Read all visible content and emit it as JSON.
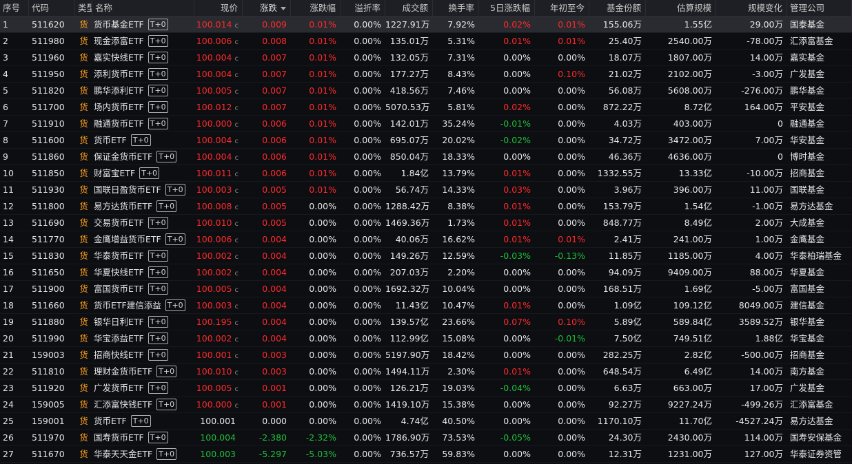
{
  "headers": [
    "序号",
    "代码",
    "类型",
    "名称",
    "现价",
    "涨跌",
    "涨跌幅",
    "溢折率",
    "成交额",
    "换手率",
    "5日涨跌幅",
    "年初至今",
    "基金份额",
    "估算规模",
    "规模变化",
    "管理公司"
  ],
  "rows": [
    {
      "no": "1",
      "code": "511620",
      "type": "货",
      "name": "货币基金ETF",
      "tag": "T+0",
      "price": "100.014",
      "chg": "0.009",
      "pct": "0.01%",
      "prem": "0.00%",
      "amount": "1227.91万",
      "turnover": "7.92%",
      "d5": "0.02%",
      "ytd": "0.01%",
      "shares": "155.06万",
      "scale": "1.55亿",
      "delta": "29.00万",
      "mgr": "国泰基金",
      "c": "red",
      "d5c": "red",
      "ytdc": "red",
      "sel": true
    },
    {
      "no": "2",
      "code": "511980",
      "type": "货",
      "name": "现金添富ETF",
      "tag": "T+0",
      "price": "100.006",
      "chg": "0.008",
      "pct": "0.01%",
      "prem": "0.00%",
      "amount": "135.01万",
      "turnover": "5.31%",
      "d5": "0.01%",
      "ytd": "0.01%",
      "shares": "25.40万",
      "scale": "2540.00万",
      "delta": "-78.00万",
      "mgr": "汇添富基金",
      "c": "red",
      "d5c": "red",
      "ytdc": "red"
    },
    {
      "no": "3",
      "code": "511960",
      "type": "货",
      "name": "嘉实快线ETF",
      "tag": "T+0",
      "price": "100.004",
      "chg": "0.007",
      "pct": "0.01%",
      "prem": "0.00%",
      "amount": "132.05万",
      "turnover": "7.31%",
      "d5": "0.00%",
      "ytd": "0.00%",
      "shares": "18.07万",
      "scale": "1807.00万",
      "delta": "14.00万",
      "mgr": "嘉实基金",
      "c": "red",
      "d5c": "white",
      "ytdc": "white"
    },
    {
      "no": "4",
      "code": "511950",
      "type": "货",
      "name": "添利货币ETF",
      "tag": "T+0",
      "price": "100.004",
      "chg": "0.007",
      "pct": "0.01%",
      "prem": "0.00%",
      "amount": "177.27万",
      "turnover": "8.43%",
      "d5": "0.00%",
      "ytd": "0.10%",
      "shares": "21.02万",
      "scale": "2102.00万",
      "delta": "-3.00万",
      "mgr": "广发基金",
      "c": "red",
      "d5c": "white",
      "ytdc": "red"
    },
    {
      "no": "5",
      "code": "511820",
      "type": "货",
      "name": "鹏华添利ETF",
      "tag": "T+0",
      "price": "100.005",
      "chg": "0.007",
      "pct": "0.01%",
      "prem": "0.00%",
      "amount": "418.56万",
      "turnover": "7.46%",
      "d5": "0.00%",
      "ytd": "0.00%",
      "shares": "56.08万",
      "scale": "5608.00万",
      "delta": "-276.00万",
      "mgr": "鹏华基金",
      "c": "red",
      "d5c": "white",
      "ytdc": "white"
    },
    {
      "no": "6",
      "code": "511700",
      "type": "货",
      "name": "场内货币ETF",
      "tag": "T+0",
      "price": "100.012",
      "chg": "0.007",
      "pct": "0.01%",
      "prem": "0.00%",
      "amount": "5070.53万",
      "turnover": "5.81%",
      "d5": "0.02%",
      "ytd": "0.00%",
      "shares": "872.22万",
      "scale": "8.72亿",
      "delta": "164.00万",
      "mgr": "平安基金",
      "c": "red",
      "d5c": "red",
      "ytdc": "white"
    },
    {
      "no": "7",
      "code": "511910",
      "type": "货",
      "name": "融通货币ETF",
      "tag": "T+0",
      "price": "100.000",
      "chg": "0.006",
      "pct": "0.01%",
      "prem": "0.00%",
      "amount": "142.01万",
      "turnover": "35.24%",
      "d5": "-0.01%",
      "ytd": "0.00%",
      "shares": "4.03万",
      "scale": "403.00万",
      "delta": "0",
      "mgr": "融通基金",
      "c": "red",
      "d5c": "green",
      "ytdc": "white"
    },
    {
      "no": "8",
      "code": "511600",
      "type": "货",
      "name": "货币ETF",
      "tag": "T+0",
      "price": "100.004",
      "chg": "0.006",
      "pct": "0.01%",
      "prem": "0.00%",
      "amount": "695.07万",
      "turnover": "20.02%",
      "d5": "-0.02%",
      "ytd": "0.00%",
      "shares": "34.72万",
      "scale": "3472.00万",
      "delta": "7.00万",
      "mgr": "华安基金",
      "c": "red",
      "d5c": "green",
      "ytdc": "white"
    },
    {
      "no": "9",
      "code": "511860",
      "type": "货",
      "name": "保证金货币ETF",
      "tag": "T+0",
      "price": "100.004",
      "chg": "0.006",
      "pct": "0.01%",
      "prem": "0.00%",
      "amount": "850.04万",
      "turnover": "18.33%",
      "d5": "0.00%",
      "ytd": "0.00%",
      "shares": "46.36万",
      "scale": "4636.00万",
      "delta": "0",
      "mgr": "博时基金",
      "c": "red",
      "d5c": "white",
      "ytdc": "white"
    },
    {
      "no": "10",
      "code": "511850",
      "type": "货",
      "name": "财富宝ETF",
      "tag": "T+0",
      "price": "100.011",
      "chg": "0.006",
      "pct": "0.01%",
      "prem": "0.00%",
      "amount": "1.84亿",
      "turnover": "13.79%",
      "d5": "0.01%",
      "ytd": "0.00%",
      "shares": "1332.55万",
      "scale": "13.33亿",
      "delta": "-10.00万",
      "mgr": "招商基金",
      "c": "red",
      "d5c": "red",
      "ytdc": "white"
    },
    {
      "no": "11",
      "code": "511930",
      "type": "货",
      "name": "国联日盈货币ETF",
      "tag": "T+0",
      "price": "100.003",
      "chg": "0.005",
      "pct": "0.01%",
      "prem": "0.00%",
      "amount": "56.74万",
      "turnover": "14.33%",
      "d5": "0.03%",
      "ytd": "0.00%",
      "shares": "3.96万",
      "scale": "396.00万",
      "delta": "11.00万",
      "mgr": "国联基金",
      "c": "red",
      "d5c": "red",
      "ytdc": "white"
    },
    {
      "no": "12",
      "code": "511800",
      "type": "货",
      "name": "易方达货币ETF",
      "tag": "T+0",
      "price": "100.008",
      "chg": "0.005",
      "pct": "0.00%",
      "prem": "0.00%",
      "amount": "1288.42万",
      "turnover": "8.38%",
      "d5": "0.01%",
      "ytd": "0.00%",
      "shares": "153.79万",
      "scale": "1.54亿",
      "delta": "-1.00万",
      "mgr": "易方达基金",
      "c": "red",
      "pc": "white",
      "d5c": "red",
      "ytdc": "white"
    },
    {
      "no": "13",
      "code": "511690",
      "type": "货",
      "name": "交易货币ETF",
      "tag": "T+0",
      "price": "100.010",
      "chg": "0.005",
      "pct": "0.00%",
      "prem": "0.00%",
      "amount": "1469.36万",
      "turnover": "1.73%",
      "d5": "0.01%",
      "ytd": "0.00%",
      "shares": "848.77万",
      "scale": "8.49亿",
      "delta": "2.00万",
      "mgr": "大成基金",
      "c": "red",
      "pc": "white",
      "d5c": "red",
      "ytdc": "white"
    },
    {
      "no": "14",
      "code": "511770",
      "type": "货",
      "name": "金鹰增益货币ETF",
      "tag": "T+0",
      "price": "100.006",
      "chg": "0.004",
      "pct": "0.00%",
      "prem": "0.00%",
      "amount": "40.06万",
      "turnover": "16.62%",
      "d5": "0.01%",
      "ytd": "0.01%",
      "shares": "2.41万",
      "scale": "241.00万",
      "delta": "1.00万",
      "mgr": "金鹰基金",
      "c": "red",
      "pc": "white",
      "d5c": "red",
      "ytdc": "red"
    },
    {
      "no": "15",
      "code": "511830",
      "type": "货",
      "name": "华泰货币ETF",
      "tag": "T+0",
      "price": "100.002",
      "chg": "0.004",
      "pct": "0.00%",
      "prem": "0.00%",
      "amount": "149.26万",
      "turnover": "12.59%",
      "d5": "-0.03%",
      "ytd": "-0.13%",
      "shares": "11.85万",
      "scale": "1185.00万",
      "delta": "4.00万",
      "mgr": "华泰柏瑞基金",
      "c": "red",
      "pc": "white",
      "d5c": "green",
      "ytdc": "green"
    },
    {
      "no": "16",
      "code": "511650",
      "type": "货",
      "name": "华夏快线ETF",
      "tag": "T+0",
      "price": "100.002",
      "chg": "0.004",
      "pct": "0.00%",
      "prem": "0.00%",
      "amount": "207.03万",
      "turnover": "2.20%",
      "d5": "0.00%",
      "ytd": "0.00%",
      "shares": "94.09万",
      "scale": "9409.00万",
      "delta": "88.00万",
      "mgr": "华夏基金",
      "c": "red",
      "pc": "white",
      "d5c": "white",
      "ytdc": "white"
    },
    {
      "no": "17",
      "code": "511900",
      "type": "货",
      "name": "富国货币ETF",
      "tag": "T+0",
      "price": "100.005",
      "chg": "0.004",
      "pct": "0.00%",
      "prem": "0.00%",
      "amount": "1692.32万",
      "turnover": "10.04%",
      "d5": "0.00%",
      "ytd": "0.00%",
      "shares": "168.51万",
      "scale": "1.69亿",
      "delta": "-5.00万",
      "mgr": "富国基金",
      "c": "red",
      "pc": "white",
      "d5c": "white",
      "ytdc": "white"
    },
    {
      "no": "18",
      "code": "511660",
      "type": "货",
      "name": "货币ETF建信添益",
      "tag": "T+0",
      "price": "100.003",
      "chg": "0.004",
      "pct": "0.00%",
      "prem": "0.00%",
      "amount": "11.43亿",
      "turnover": "10.47%",
      "d5": "0.01%",
      "ytd": "0.00%",
      "shares": "1.09亿",
      "scale": "109.12亿",
      "delta": "8049.00万",
      "mgr": "建信基金",
      "c": "red",
      "pc": "white",
      "d5c": "red",
      "ytdc": "white"
    },
    {
      "no": "19",
      "code": "511880",
      "type": "货",
      "name": "银华日利ETF",
      "tag": "T+0",
      "price": "100.195",
      "chg": "0.004",
      "pct": "0.00%",
      "prem": "0.00%",
      "amount": "139.57亿",
      "turnover": "23.66%",
      "d5": "0.07%",
      "ytd": "0.10%",
      "shares": "5.89亿",
      "scale": "589.84亿",
      "delta": "3589.52万",
      "mgr": "银华基金",
      "c": "red",
      "pc": "white",
      "d5c": "red",
      "ytdc": "red"
    },
    {
      "no": "20",
      "code": "511990",
      "type": "货",
      "name": "华宝添益ETF",
      "tag": "T+0",
      "price": "100.002",
      "chg": "0.004",
      "pct": "0.00%",
      "prem": "0.00%",
      "amount": "112.99亿",
      "turnover": "15.08%",
      "d5": "0.00%",
      "ytd": "-0.01%",
      "shares": "7.50亿",
      "scale": "749.51亿",
      "delta": "1.88亿",
      "mgr": "华宝基金",
      "c": "red",
      "pc": "white",
      "d5c": "white",
      "ytdc": "green"
    },
    {
      "no": "21",
      "code": "159003",
      "type": "货",
      "name": "招商快线ETF",
      "tag": "T+0",
      "price": "100.001",
      "chg": "0.003",
      "pct": "0.00%",
      "prem": "0.00%",
      "amount": "5197.90万",
      "turnover": "18.42%",
      "d5": "0.00%",
      "ytd": "0.00%",
      "shares": "282.25万",
      "scale": "2.82亿",
      "delta": "-500.00万",
      "mgr": "招商基金",
      "c": "red",
      "pc": "white",
      "d5c": "white",
      "ytdc": "white"
    },
    {
      "no": "22",
      "code": "511810",
      "type": "货",
      "name": "理财金货币ETF",
      "tag": "T+0",
      "price": "100.010",
      "chg": "0.003",
      "pct": "0.00%",
      "prem": "0.00%",
      "amount": "1494.11万",
      "turnover": "2.30%",
      "d5": "0.01%",
      "ytd": "0.00%",
      "shares": "648.54万",
      "scale": "6.49亿",
      "delta": "14.00万",
      "mgr": "南方基金",
      "c": "red",
      "pc": "white",
      "d5c": "red",
      "ytdc": "white"
    },
    {
      "no": "23",
      "code": "511920",
      "type": "货",
      "name": "广发货币ETF",
      "tag": "T+0",
      "price": "100.005",
      "chg": "0.001",
      "pct": "0.00%",
      "prem": "0.00%",
      "amount": "126.21万",
      "turnover": "19.03%",
      "d5": "-0.04%",
      "ytd": "0.00%",
      "shares": "6.63万",
      "scale": "663.00万",
      "delta": "17.00万",
      "mgr": "广发基金",
      "c": "red",
      "pc": "white",
      "d5c": "green",
      "ytdc": "white"
    },
    {
      "no": "24",
      "code": "159005",
      "type": "货",
      "name": "汇添富快钱ETF",
      "tag": "T+0",
      "price": "100.000",
      "chg": "0.001",
      "pct": "0.00%",
      "prem": "0.00%",
      "amount": "1419.10万",
      "turnover": "15.38%",
      "d5": "0.00%",
      "ytd": "0.00%",
      "shares": "92.27万",
      "scale": "9227.24万",
      "delta": "-499.26万",
      "mgr": "汇添富基金",
      "c": "red",
      "pc": "white",
      "d5c": "white",
      "ytdc": "white"
    },
    {
      "no": "25",
      "code": "159001",
      "type": "货",
      "name": "货币ETF",
      "tag": "T+0",
      "price": "100.001",
      "chg": "0.000",
      "pct": "0.00%",
      "prem": "0.00%",
      "amount": "4.74亿",
      "turnover": "40.50%",
      "d5": "0.00%",
      "ytd": "0.00%",
      "shares": "1170.10万",
      "scale": "11.70亿",
      "delta": "-4527.24万",
      "mgr": "易方达基金",
      "c": "white",
      "pc": "white",
      "d5c": "white",
      "ytdc": "white",
      "noC": true
    },
    {
      "no": "26",
      "code": "511970",
      "type": "货",
      "name": "国寿货币ETF",
      "tag": "T+0",
      "price": "100.004",
      "chg": "-2.380",
      "pct": "-2.32%",
      "prem": "0.00%",
      "amount": "1786.90万",
      "turnover": "73.53%",
      "d5": "-0.05%",
      "ytd": "0.00%",
      "shares": "24.30万",
      "scale": "2430.00万",
      "delta": "114.00万",
      "mgr": "国寿安保基金",
      "c": "green",
      "d5c": "green",
      "ytdc": "white",
      "noC": true
    },
    {
      "no": "27",
      "code": "511670",
      "type": "货",
      "name": "华泰天天金ETF",
      "tag": "T+0",
      "price": "100.003",
      "chg": "-5.297",
      "pct": "-5.03%",
      "prem": "0.00%",
      "amount": "736.57万",
      "turnover": "59.83%",
      "d5": "0.00%",
      "ytd": "0.00%",
      "shares": "12.31万",
      "scale": "1231.00万",
      "delta": "127.00万",
      "mgr": "华泰证券资管",
      "c": "green",
      "d5c": "white",
      "ytdc": "white",
      "noC": true
    }
  ],
  "c_marker": "c",
  "colors": {
    "up": "#ff2a2a",
    "down": "#1fbf3a",
    "flat": "#e8e8e8",
    "type": "#ff9f1c",
    "bg": "#0d0e12"
  }
}
